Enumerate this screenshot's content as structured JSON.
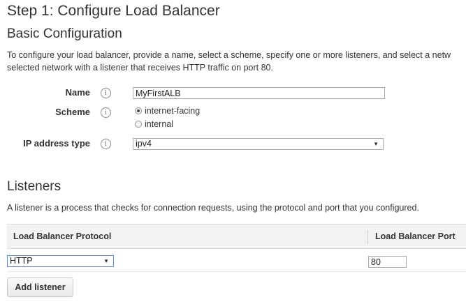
{
  "page": {
    "step_title": "Step 1: Configure Load Balancer"
  },
  "basic": {
    "heading": "Basic Configuration",
    "description_line1": "To configure your load balancer, provide a name, select a scheme, specify one or more listeners, and select a netw",
    "description_line2": "selected network with a listener that receives HTTP traffic on port 80.",
    "name_label": "Name",
    "name_value": "MyFirstALB",
    "scheme_label": "Scheme",
    "scheme_options": [
      "internet-facing",
      "internal"
    ],
    "scheme_selected": "internet-facing",
    "ip_label": "IP address type",
    "ip_value": "ipv4",
    "info_glyph": "i"
  },
  "listeners": {
    "heading": "Listeners",
    "description": "A listener is a process that checks for connection requests, using the protocol and port that you configured.",
    "columns": [
      "Load Balancer Protocol",
      "Load Balancer Port"
    ],
    "rows": [
      {
        "protocol": "HTTP",
        "port": "80"
      }
    ],
    "add_button": "Add listener"
  },
  "icons": {
    "info": "info-circle-icon",
    "dropdown": "chevron-down-icon"
  }
}
